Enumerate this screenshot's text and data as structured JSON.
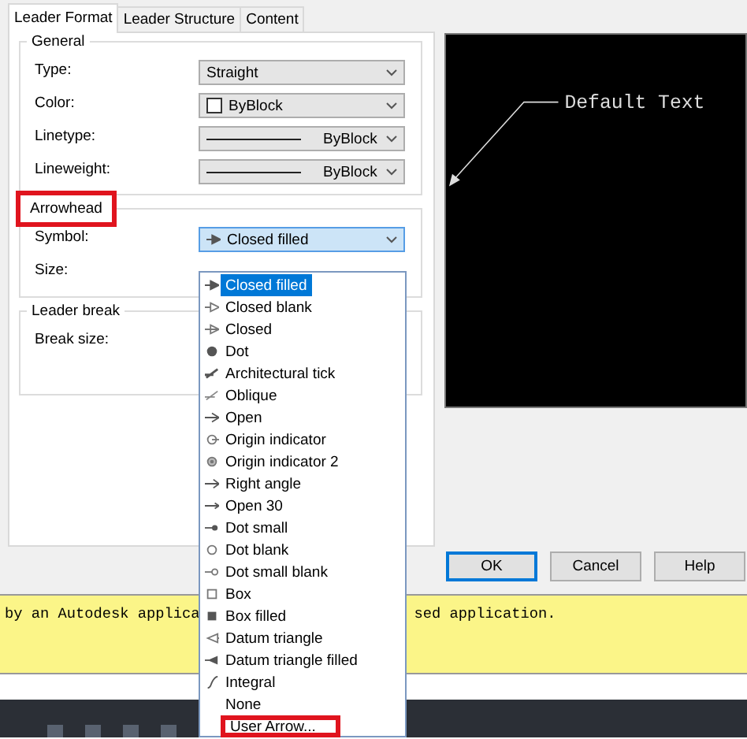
{
  "tabs": [
    {
      "label": "Leader Format",
      "selected": true
    },
    {
      "label": "Leader Structure",
      "selected": false
    },
    {
      "label": "Content",
      "selected": false
    }
  ],
  "groups": [
    {
      "title": "General",
      "highlighted": false,
      "rows": [
        {
          "label": "Type:",
          "kind": "plain",
          "value": "Straight",
          "open": false
        },
        {
          "label": "Color:",
          "kind": "color",
          "value": "ByBlock",
          "open": false
        },
        {
          "label": "Linetype:",
          "kind": "line",
          "value": "ByBlock",
          "open": false
        },
        {
          "label": "Lineweight:",
          "kind": "line",
          "value": "ByBlock",
          "open": false
        }
      ]
    },
    {
      "title": "Arrowhead",
      "highlighted": true,
      "rows": [
        {
          "label": "Symbol:",
          "kind": "symbol",
          "value": "Closed filled",
          "open": true
        },
        {
          "label": "Size:",
          "kind": "hidden"
        }
      ]
    },
    {
      "title": "Leader break",
      "highlighted": false,
      "rows": [
        {
          "label": "Break size:",
          "kind": "hidden"
        }
      ]
    }
  ],
  "preview": {
    "text": "Default Text"
  },
  "dropdown": [
    {
      "label": "Closed filled",
      "selected": true,
      "highlighted": false
    },
    {
      "label": "Closed blank",
      "selected": false,
      "highlighted": false
    },
    {
      "label": "Closed",
      "selected": false,
      "highlighted": false
    },
    {
      "label": "Dot",
      "selected": false,
      "highlighted": false
    },
    {
      "label": "Architectural tick",
      "selected": false,
      "highlighted": false
    },
    {
      "label": "Oblique",
      "selected": false,
      "highlighted": false
    },
    {
      "label": "Open",
      "selected": false,
      "highlighted": false
    },
    {
      "label": "Origin indicator",
      "selected": false,
      "highlighted": false
    },
    {
      "label": "Origin indicator 2",
      "selected": false,
      "highlighted": false
    },
    {
      "label": "Right angle",
      "selected": false,
      "highlighted": false
    },
    {
      "label": "Open 30",
      "selected": false,
      "highlighted": false
    },
    {
      "label": "Dot small",
      "selected": false,
      "highlighted": false
    },
    {
      "label": "Dot blank",
      "selected": false,
      "highlighted": false
    },
    {
      "label": "Dot small blank",
      "selected": false,
      "highlighted": false
    },
    {
      "label": "Box",
      "selected": false,
      "highlighted": false
    },
    {
      "label": "Box filled",
      "selected": false,
      "highlighted": false
    },
    {
      "label": "Datum triangle",
      "selected": false,
      "highlighted": false
    },
    {
      "label": "Datum triangle filled",
      "selected": false,
      "highlighted": false
    },
    {
      "label": "Integral",
      "selected": false,
      "highlighted": false
    },
    {
      "label": "None",
      "selected": false,
      "highlighted": false
    },
    {
      "label": "User Arrow...",
      "selected": false,
      "highlighted": true
    }
  ],
  "buttons": [
    {
      "label": "OK",
      "default": true
    },
    {
      "label": "Cancel",
      "default": false
    },
    {
      "label": "Help",
      "default": false
    }
  ],
  "command_line": [
    "by an Autodesk applica",
    "sed application."
  ]
}
